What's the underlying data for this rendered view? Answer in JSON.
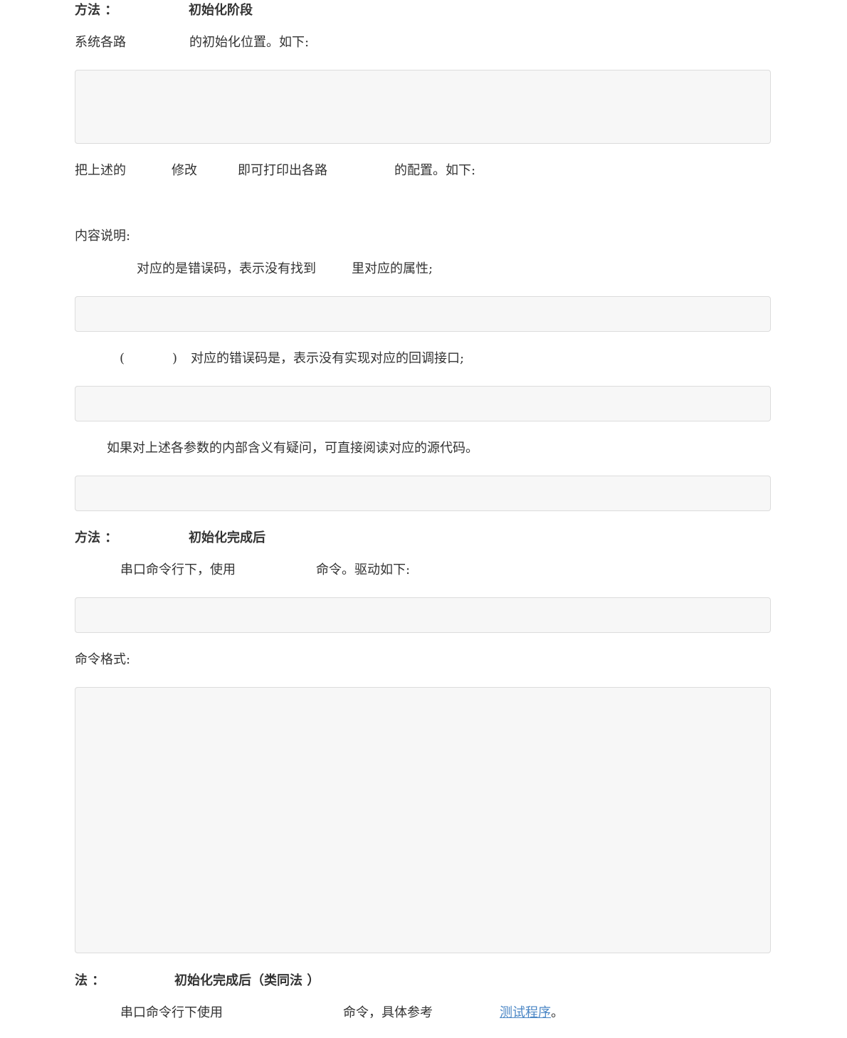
{
  "method1": {
    "prefix": "方法 ：",
    "title": "初始化阶段"
  },
  "p1": {
    "a": "系统各路",
    "b": "的初始化位置。如下:"
  },
  "p2": {
    "a": "把上述的",
    "b": "修改",
    "c": "即可打印出各路",
    "d": "的配置。如下:"
  },
  "content_label": "内容说明:",
  "p3": {
    "a": "对应的是错误码，表示没有找到",
    "b": "里对应的属性;"
  },
  "p4": {
    "open": "(",
    "close": ")",
    "text": "对应的错误码是，表示没有实现对应的回调接口;"
  },
  "p5": "如果对上述各参数的内部含义有疑问，可直接阅读对应的源代码。",
  "method2": {
    "prefix": "方法 ：",
    "title": "初始化完成后"
  },
  "p6": {
    "a": "串口命令行下，使用",
    "b": "命令。驱动如下:"
  },
  "format_label": "命令格式:",
  "method3": {
    "prefix": "法 ：",
    "title": "初始化完成后（类同法 ）"
  },
  "p7": {
    "a": "串口命令行下使用",
    "b": "命令，具体参考",
    "link": "测试程序",
    "end": "。"
  }
}
